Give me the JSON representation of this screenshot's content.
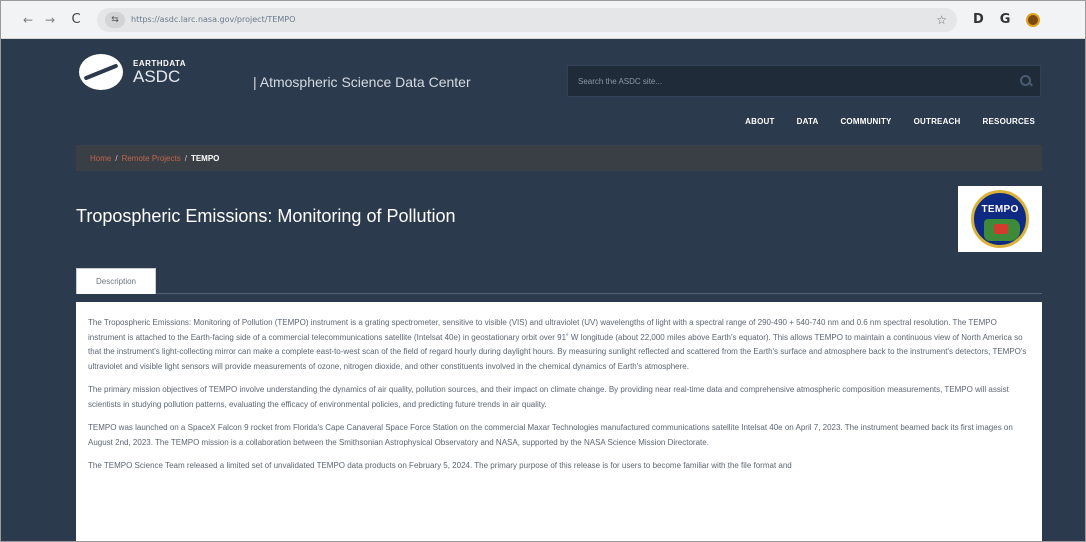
{
  "browser": {
    "url": "https://asdc.larc.nasa.gov/project/TEMPO",
    "back_glyph": "←",
    "forward_glyph": "→",
    "reload_glyph": "C",
    "site_info_glyph": "⇆",
    "star_glyph": "☆",
    "ext1_glyph": "D",
    "ext2_glyph": "G"
  },
  "header": {
    "logo_earthdata": "EARTHDATA",
    "logo_asdc": "ASDC",
    "tagline": "| Atmospheric Science Data Center",
    "search_placeholder": "Search the ASDC site..."
  },
  "nav": {
    "items": [
      "ABOUT",
      "DATA",
      "COMMUNITY",
      "OUTREACH",
      "RESOURCES"
    ]
  },
  "breadcrumb": {
    "home": "Home",
    "sep1": "/",
    "parent": "Remote Projects",
    "sep2": "/",
    "current": "TEMPO"
  },
  "page": {
    "title": "Tropospheric Emissions: Monitoring of Pollution",
    "logo_text": "TEMPO",
    "tab_description": "Description"
  },
  "description": {
    "paragraphs": [
      "The Tropospheric Emissions: Monitoring of Pollution (TEMPO) instrument is a grating spectrometer, sensitive to visible (VIS) and ultraviolet (UV) wavelengths of light with a spectral range of 290-490 + 540-740 nm and 0.6 nm spectral resolution. The TEMPO instrument is attached to the Earth-facing side of a commercial telecommunications satellite (Intelsat 40e) in geostationary orbit over 91˚ W longitude (about 22,000 miles above Earth's equator). This allows TEMPO to maintain a continuous view of North America so that the instrument's light-collecting mirror can make a complete east-to-west scan of the field of regard hourly during daylight hours. By measuring sunlight reflected and scattered from the Earth's surface and atmosphere back to the instrument's detectors, TEMPO's ultraviolet and visible light sensors will provide measurements of ozone, nitrogen dioxide, and other constituents involved in the chemical dynamics of Earth's atmosphere.",
      "The primary mission objectives of TEMPO involve understanding the dynamics of air quality, pollution sources, and their impact on climate change. By providing near real-time data and comprehensive atmospheric composition measurements, TEMPO will assist scientists in studying pollution patterns, evaluating the efficacy of environmental policies, and predicting future trends in air quality.",
      "TEMPO was launched on a SpaceX Falcon 9 rocket from Florida's Cape Canaveral Space Force Station on the commercial Maxar Technologies manufactured communications satellite Intelsat 40e on April 7, 2023. The instrument beamed back its first images on August 2nd, 2023. The TEMPO mission is a collaboration between the Smithsonian Astrophysical Observatory and NASA, supported by the NASA Science Mission Directorate.",
      "The TEMPO Science Team released a limited set of unvalidated TEMPO data products on February 5, 2024. The primary purpose of this release is for users to become familiar with the file format and"
    ]
  }
}
